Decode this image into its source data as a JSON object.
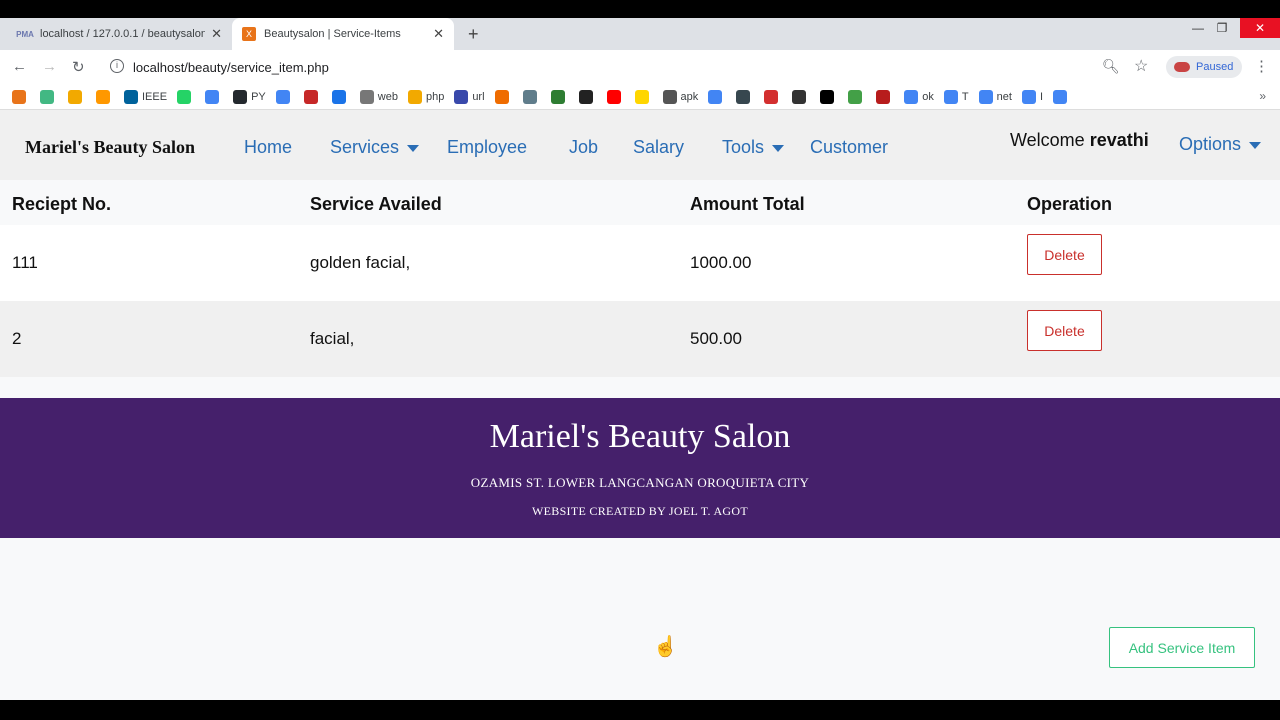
{
  "browser": {
    "tabs": [
      {
        "title": "localhost / 127.0.0.1 / beautysalon",
        "favicon": "PMA"
      },
      {
        "title": "Beautysalon | Service-Items",
        "favicon": "X"
      }
    ],
    "url": "localhost/beauty/service_item.php",
    "profile_status": "Paused",
    "bookmarks": [
      {
        "label": "",
        "color": "#e8741a"
      },
      {
        "label": "",
        "color": "#42b883"
      },
      {
        "label": "",
        "color": "#f2a900"
      },
      {
        "label": "",
        "color": "#ff9800"
      },
      {
        "label": "IEEE",
        "color": "#00629b"
      },
      {
        "label": "",
        "color": "#25d366"
      },
      {
        "label": "",
        "color": "#4285f4"
      },
      {
        "label": "PY",
        "color": "#24292e"
      },
      {
        "label": "",
        "color": "#4285f4"
      },
      {
        "label": "",
        "color": "#c62828"
      },
      {
        "label": "",
        "color": "#1a73e8"
      },
      {
        "label": "web",
        "color": "#777777"
      },
      {
        "label": "php",
        "color": "#f2a900"
      },
      {
        "label": "url",
        "color": "#3949ab"
      },
      {
        "label": "",
        "color": "#ef6c00"
      },
      {
        "label": "",
        "color": "#607d8b"
      },
      {
        "label": "",
        "color": "#2e7d32"
      },
      {
        "label": "",
        "color": "#222222"
      },
      {
        "label": "",
        "color": "#ff0000"
      },
      {
        "label": "",
        "color": "#ffd600"
      },
      {
        "label": "apk",
        "color": "#555555"
      },
      {
        "label": "",
        "color": "#4285f4"
      },
      {
        "label": "",
        "color": "#37474f"
      },
      {
        "label": "",
        "color": "#d32f2f"
      },
      {
        "label": "",
        "color": "#333333"
      },
      {
        "label": "",
        "color": "#000000"
      },
      {
        "label": "",
        "color": "#43a047"
      },
      {
        "label": "",
        "color": "#b71c1c"
      },
      {
        "label": "ok",
        "color": "#4285f4"
      },
      {
        "label": "T",
        "color": "#4285f4"
      },
      {
        "label": "net",
        "color": "#4285f4"
      },
      {
        "label": "I",
        "color": "#4285f4"
      },
      {
        "label": "",
        "color": "#4285f4"
      }
    ]
  },
  "nav": {
    "brand": "Mariel's Beauty Salon",
    "links": {
      "home": "Home",
      "services": "Services",
      "employee": "Employee",
      "job": "Job",
      "salary": "Salary",
      "tools": "Tools",
      "customer": "Customer",
      "options": "Options"
    },
    "welcome_prefix": "Welcome",
    "username": "revathi"
  },
  "table": {
    "headers": [
      "Reciept No.",
      "Service Availed",
      "Amount Total",
      "Operation"
    ],
    "rows": [
      {
        "receipt": "111",
        "service": "golden facial,",
        "amount": "1000.00",
        "action": "Delete"
      },
      {
        "receipt": "2",
        "service": "facial,",
        "amount": "500.00",
        "action": "Delete"
      }
    ]
  },
  "footer": {
    "title": "Mariel's Beauty Salon",
    "address": "OZAMIS ST. LOWER LANGCANGAN OROQUIETA CITY",
    "credit": "WEBSITE CREATED BY JOEL T. AGOT"
  },
  "add_button": "Add Service Item",
  "colors": {
    "link": "#2a6db5",
    "footer_bg": "#45206b",
    "danger": "#c9302c",
    "success": "#36c27f"
  }
}
